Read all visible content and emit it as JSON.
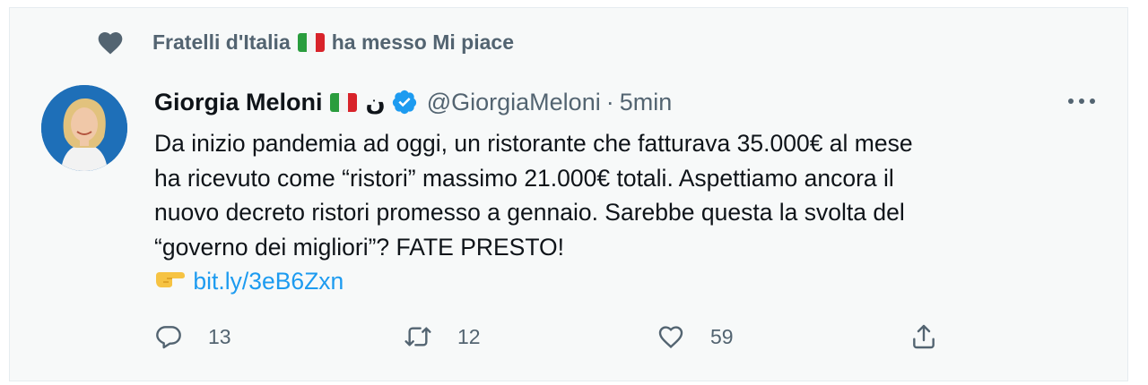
{
  "social_context": {
    "account": "Fratelli d'Italia",
    "action": "ha messo Mi piace"
  },
  "tweet": {
    "author_name": "Giorgia Meloni",
    "author_suffix": "ن",
    "handle": "@GiorgiaMeloni",
    "separator": "·",
    "time": "5min",
    "text_lines": [
      "Da inizio pandemia ad oggi, un ristorante che fatturava 35.000€ al mese",
      "ha ricevuto come “ristori” massimo 21.000€ totali. Aspettiamo ancora il",
      "nuovo decreto ristori promesso a gennaio. Sarebbe questa la svolta del",
      "“governo dei migliori”? FATE PRESTO!"
    ],
    "link": "bit.ly/3eB6Zxn"
  },
  "actions": {
    "replies": "13",
    "retweets": "12",
    "likes": "59"
  },
  "colors": {
    "link": "#1d9bf0",
    "muted": "#536471",
    "background": "#f7f9f9"
  },
  "icons": [
    "heart-icon",
    "italy-flag-icon",
    "verified-badge-icon",
    "more-icon",
    "pointing-hand-icon",
    "reply-icon",
    "retweet-icon",
    "like-icon",
    "share-icon"
  ]
}
